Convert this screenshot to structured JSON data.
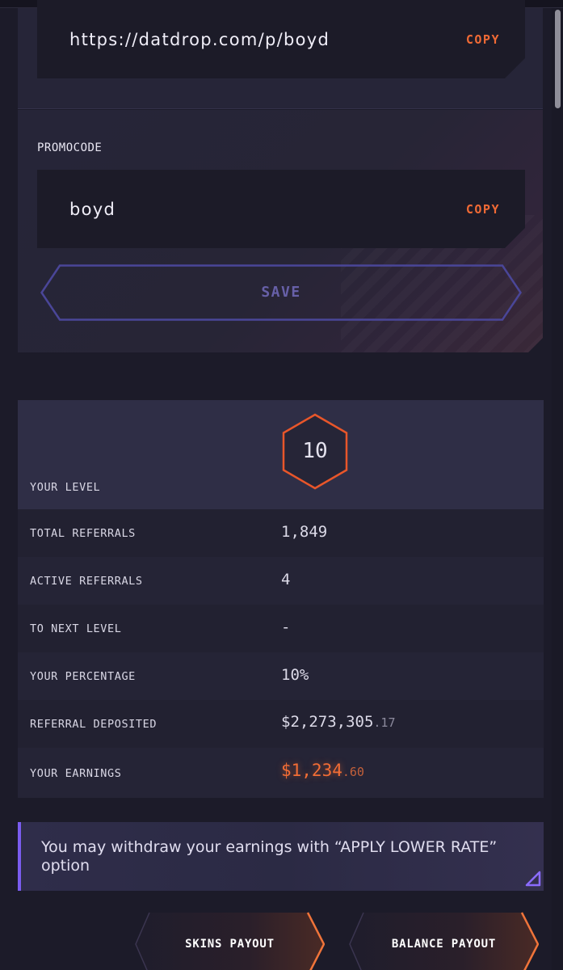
{
  "referral_link": {
    "value": "https://datdrop.com/p/boyd",
    "copy_label": "COPY"
  },
  "promocode": {
    "label": "PROMOCODE",
    "value": "boyd",
    "copy_label": "COPY"
  },
  "save_label": "SAVE",
  "stats": {
    "level": {
      "label": "YOUR LEVEL",
      "value": "10"
    },
    "total_referrals": {
      "label": "TOTAL REFERRALS",
      "value": "1,849"
    },
    "active_referrals": {
      "label": "ACTIVE REFERRALS",
      "value": "4"
    },
    "to_next_level": {
      "label": "TO NEXT LEVEL",
      "value": "-"
    },
    "your_percentage": {
      "label": "YOUR PERCENTAGE",
      "value": "10%"
    },
    "referral_deposited": {
      "label": "REFERRAL DEPOSITED",
      "dollars": "$2,273,305",
      "cents": ".17"
    },
    "your_earnings": {
      "label": "YOUR EARNINGS",
      "dollars": "$1,234",
      "cents": ".60"
    }
  },
  "notice": {
    "text": "You may withdraw your earnings with “APPLY LOWER RATE” option"
  },
  "buttons": {
    "skins_payout": "SKINS PAYOUT",
    "balance_payout": "BALANCE PAYOUT"
  },
  "colors": {
    "accent_orange": "#f06a35",
    "accent_purple": "#7a5cf0",
    "panel_bg": "#262538"
  },
  "icons": {
    "level_badge": "hexagon-icon",
    "notice_corner": "corner-triangle-icon"
  }
}
